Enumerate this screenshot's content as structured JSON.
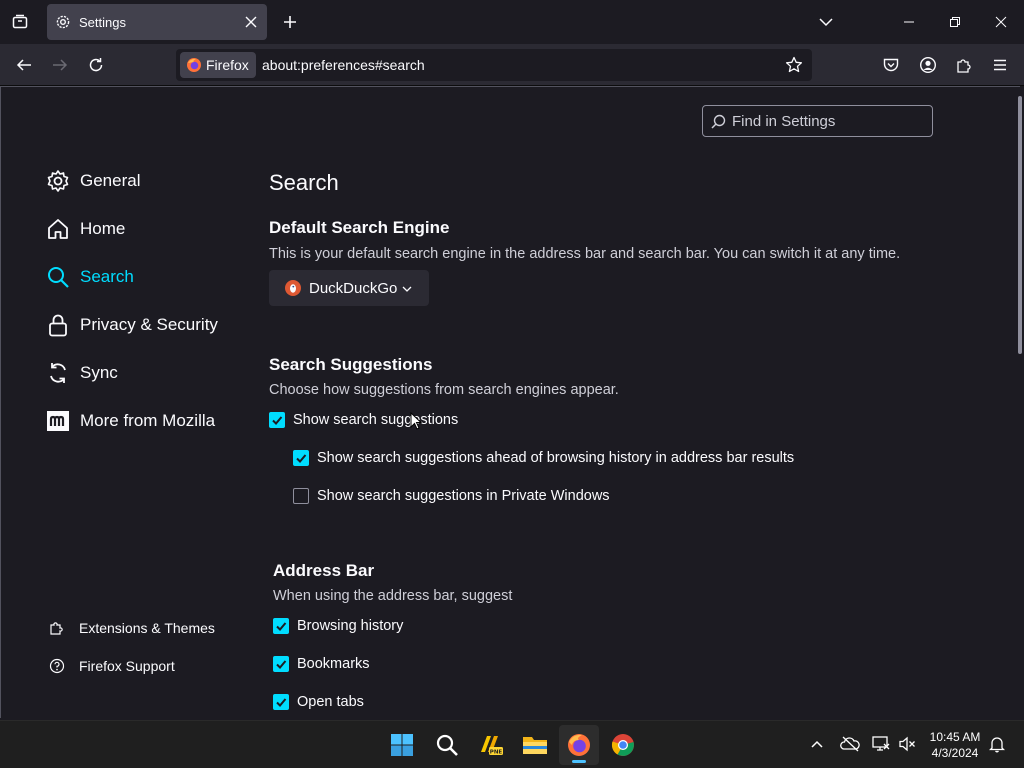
{
  "browser": {
    "tab": {
      "title": "Settings"
    },
    "identity_label": "Firefox",
    "url": "about:preferences#search"
  },
  "settings": {
    "find_placeholder": "Find in Settings",
    "categories": [
      {
        "label": "General",
        "icon": "gear-icon"
      },
      {
        "label": "Home",
        "icon": "home-icon"
      },
      {
        "label": "Search",
        "icon": "search-icon",
        "selected": true
      },
      {
        "label": "Privacy & Security",
        "icon": "lock-icon"
      },
      {
        "label": "Sync",
        "icon": "sync-icon"
      },
      {
        "label": "More from Mozilla",
        "icon": "mozilla-icon"
      }
    ],
    "footer_links": [
      {
        "label": "Extensions & Themes",
        "icon": "puzzle-icon"
      },
      {
        "label": "Firefox Support",
        "icon": "help-icon"
      }
    ],
    "page_title": "Search",
    "default_engine": {
      "heading": "Default Search Engine",
      "description": "This is your default search engine in the address bar and search bar. You can switch it at any time.",
      "selected": "DuckDuckGo"
    },
    "suggestions": {
      "heading": "Search Suggestions",
      "description": "Choose how suggestions from search engines appear.",
      "options": [
        {
          "label": "Show search suggestions",
          "checked": true
        },
        {
          "label": "Show search suggestions ahead of browsing history in address bar results",
          "checked": true
        },
        {
          "label": "Show search suggestions in Private Windows",
          "checked": false
        }
      ]
    },
    "address_bar": {
      "heading": "Address Bar",
      "description": "When using the address bar, suggest",
      "options": [
        {
          "label": "Browsing history",
          "checked": true
        },
        {
          "label": "Bookmarks",
          "checked": true
        },
        {
          "label": "Open tabs",
          "checked": true
        }
      ]
    }
  },
  "taskbar": {
    "apps": [
      "windows-start-icon",
      "search-icon",
      "pne-app-icon",
      "file-explorer-icon",
      "firefox-icon",
      "chrome-icon"
    ],
    "clock_time": "10:45 AM",
    "clock_date": "4/3/2024"
  },
  "colors": {
    "accent": "#00ddff",
    "background": "#1c1b22",
    "toolbar": "#2b2a33"
  }
}
